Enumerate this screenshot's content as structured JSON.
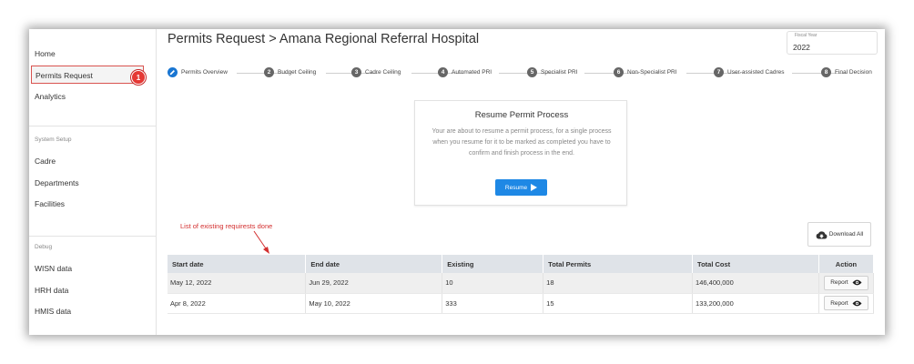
{
  "sidebar": {
    "items_top": [
      "Home",
      "Permits Request",
      "Analytics"
    ],
    "active_badge": "1",
    "system_setup_label": "System Setup",
    "setup_items": [
      "Cadre",
      "Departments",
      "Facilities"
    ],
    "debug_label": "Debug",
    "debug_items": [
      "WISN data",
      "HRH data",
      "HMIS data"
    ]
  },
  "header": {
    "title": "Permits Request > Amana Regional Referral Hospital",
    "fiscal_year_label": "Fiscal Year",
    "fiscal_year_value": "2022"
  },
  "stepper": [
    {
      "num": "",
      "label": "Permits Overview",
      "active": true
    },
    {
      "num": "2",
      "label": "Budget Ceiling"
    },
    {
      "num": "3",
      "label": "Cadre Ceiling"
    },
    {
      "num": "4",
      "label": "Automated PRI"
    },
    {
      "num": "5",
      "label": "Specialist PRI"
    },
    {
      "num": "6",
      "label": "Non-Specialist PRI"
    },
    {
      "num": "7",
      "label": "User-assisted Cadres"
    },
    {
      "num": "8",
      "label": "Final Decision"
    }
  ],
  "resume_card": {
    "title": "Resume Permit Process",
    "text": "Your are about to resume a permit process, for a single process when you resume for it to be marked as completed you have to confirm and finish process in the end.",
    "button": "Resume"
  },
  "annotation": "List of existing requirests done",
  "download_button": "Download All",
  "table": {
    "headers": [
      "Start date",
      "End date",
      "Existing",
      "Total Permits",
      "Total Cost",
      "Action"
    ],
    "rows": [
      {
        "start": "May 12, 2022",
        "end": "Jun 29, 2022",
        "existing": "10",
        "permits": "18",
        "cost": "146,400,000",
        "action": "Report"
      },
      {
        "start": "Apr 8, 2022",
        "end": "May 10, 2022",
        "existing": "333",
        "permits": "15",
        "cost": "133,200,000",
        "action": "Report"
      }
    ]
  },
  "colors": {
    "primary": "#1e88e5",
    "badge": "#e53935",
    "annotation": "#d32f2f"
  },
  "icons": [
    "pencil-icon",
    "play-icon",
    "cloud-download-icon",
    "eye-icon"
  ]
}
